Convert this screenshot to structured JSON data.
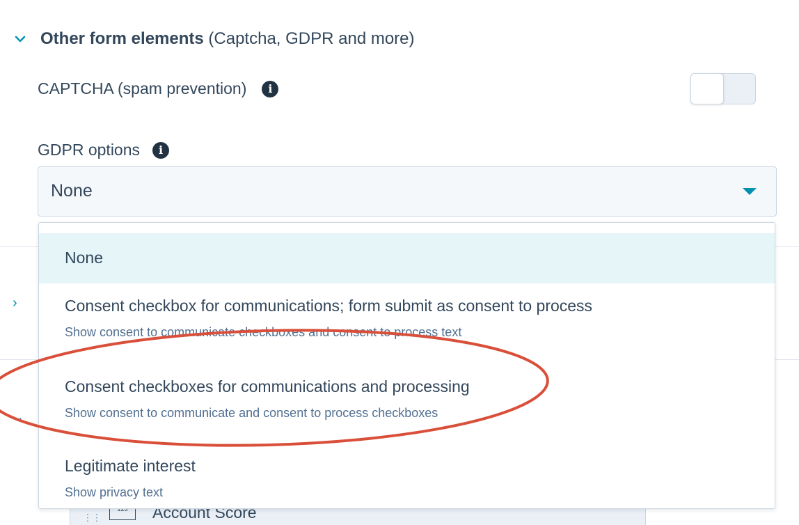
{
  "section": {
    "title_bold": "Other form elements",
    "title_rest": " (Captcha, GDPR and more)"
  },
  "captcha": {
    "label": "CAPTCHA (spam prevention)",
    "enabled": false
  },
  "gdpr": {
    "label": "GDPR options",
    "selected_value": "None",
    "options": [
      {
        "title": "None",
        "subtitle": ""
      },
      {
        "title": "Consent checkbox for communications; form submit as consent to process",
        "subtitle": "Show consent to communicate checkboxes and consent to process text"
      },
      {
        "title": "Consent checkboxes for communications and processing",
        "subtitle": "Show consent to communicate and consent to process checkboxes"
      },
      {
        "title": "Legitimate interest",
        "subtitle": "Show privacy text"
      }
    ]
  },
  "background_field": {
    "label": "Account Score",
    "icon_text": "123"
  },
  "colors": {
    "accent": "#0091ae",
    "text": "#33475b",
    "annotation": "#d94f3a",
    "selected_bg": "#e5f5f8"
  },
  "icons": {
    "section_toggle": "chevron-down-icon",
    "info": "info-icon",
    "caret": "caret-down-icon"
  }
}
